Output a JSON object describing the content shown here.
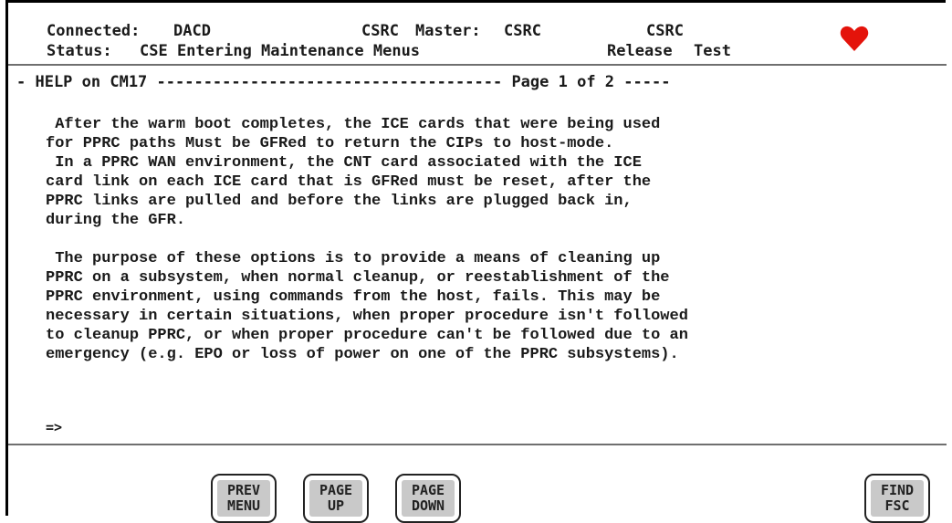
{
  "header": {
    "connected_label": "Connected:",
    "connected_value": "DACD",
    "csrc_1": "CSRC",
    "master_label": "Master:",
    "master_value": "CSRC",
    "csrc_2": "CSRC",
    "status_label": "Status:",
    "status_value": "CSE Entering Maintenance Menus",
    "release_label": "Release",
    "release_value": "Test",
    "heart_color": "#e4130b"
  },
  "help": {
    "title_line": "- HELP on CM17 ------------------------------------- Page 1 of 2 -----",
    "paragraph1": [
      " After the warm boot completes, the ICE cards that were being used",
      "for PPRC paths Must be GFRed to return the CIPs to host-mode.",
      " In a PPRC WAN environment, the CNT card associated with the ICE",
      "card link on each ICE card that is GFRed must be reset, after the",
      "PPRC links are pulled and before the links are plugged back in,",
      "during the GFR."
    ],
    "paragraph2": [
      " The purpose of these options is to provide a means of cleaning up",
      "PPRC on a subsystem, when normal cleanup, or reestablishment of the",
      "PPRC environment, using commands from the host, fails. This may be",
      "necessary in certain situations, when proper procedure isn't followed",
      "to cleanup PPRC, or when proper procedure can't be followed due to an",
      "emergency (e.g. EPO or loss of power on one of the PPRC subsystems)."
    ],
    "prompt": "=>"
  },
  "buttons": {
    "prev_menu": [
      "PREV",
      "MENU"
    ],
    "page_up": [
      "PAGE",
      "UP"
    ],
    "page_down": [
      "PAGE",
      "DOWN"
    ],
    "find_fsc": [
      "FIND",
      "FSC"
    ]
  }
}
